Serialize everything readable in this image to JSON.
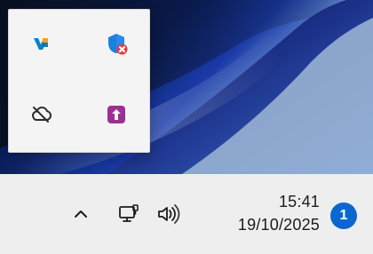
{
  "taskbar": {
    "clock": {
      "time": "15:41",
      "date": "19/10/2025"
    },
    "notifications": {
      "count": "1"
    }
  },
  "tray": {
    "overflow": {
      "icons": [
        {
          "name": "vs-code-icon"
        },
        {
          "name": "security-alert-icon"
        },
        {
          "name": "cloud-offline-icon"
        },
        {
          "name": "upload-app-icon"
        }
      ]
    }
  },
  "colors": {
    "taskbar_bg": "#eeeeee",
    "flyout_bg": "#f4f4f4",
    "accent_blue": "#0b67d0",
    "alert_red": "#e23b3b",
    "purple_app": "#9b2f93"
  }
}
